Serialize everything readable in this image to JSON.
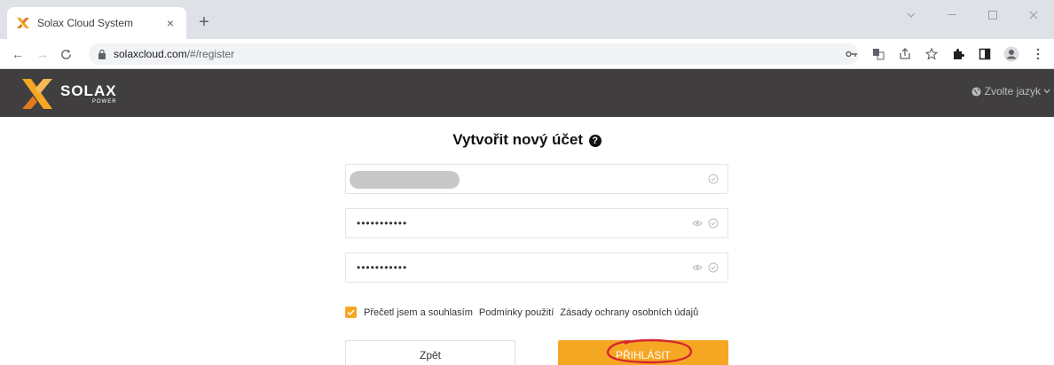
{
  "browser": {
    "tab_title": "Solax Cloud System",
    "tab_close": "×",
    "new_tab": "+",
    "url_host": "solaxcloud.com",
    "url_path": "/#/register",
    "nav_back": "←",
    "nav_forward": "→",
    "nav_reload": "C",
    "icons": [
      "key-icon",
      "translate-icon",
      "share-icon",
      "bookmark-star-icon",
      "extensions-icon",
      "sidepanel-icon",
      "profile-icon",
      "more-icon"
    ]
  },
  "header": {
    "logo_word": "SOLAX",
    "logo_sub": "POWER",
    "language_label": "Zvolte jazyk"
  },
  "form": {
    "title": "Vytvořit nový účet",
    "help_glyph": "?",
    "username_value": "",
    "password_value": "•••••••••••",
    "confirm_value": "•••••••••••",
    "agree_text": "Přečetl jsem a souhlasím",
    "terms_link": "Podmínky použití",
    "privacy_link": "Zásady ochrany osobních údajů",
    "back_label": "Zpět",
    "submit_label": "PŘIHLÁSIT"
  },
  "colors": {
    "accent": "#f5a623",
    "header_bg": "#403e3f",
    "annotation": "#d6262f"
  }
}
